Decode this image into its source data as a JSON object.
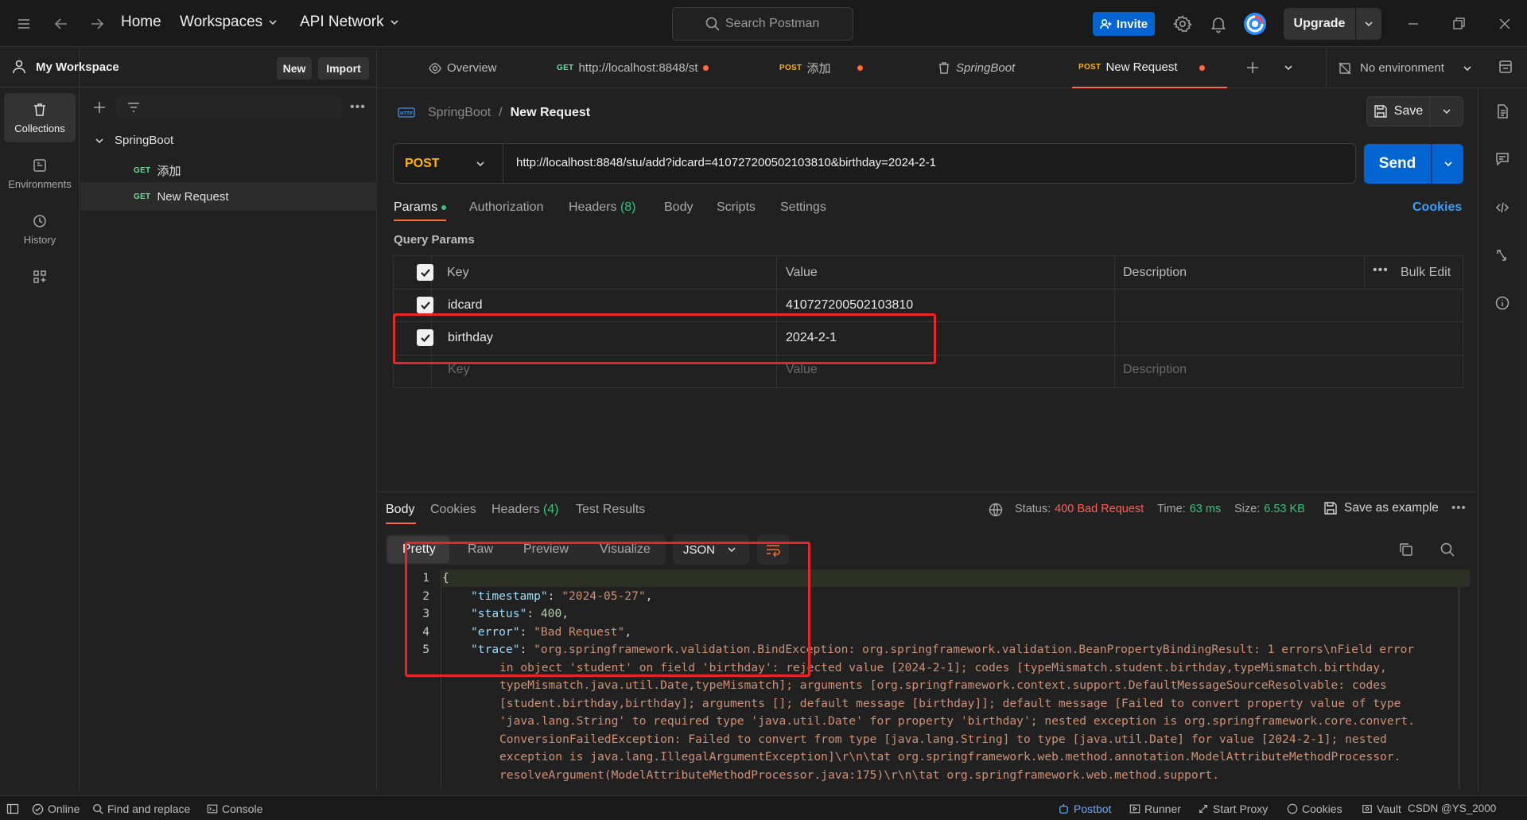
{
  "topbar": {
    "home": "Home",
    "workspaces": "Workspaces",
    "api_network": "API Network",
    "search_placeholder": "Search Postman",
    "invite": "Invite",
    "upgrade": "Upgrade"
  },
  "rail": {
    "collections": "Collections",
    "environments": "Environments",
    "history": "History"
  },
  "sidebar": {
    "workspace": "My Workspace",
    "new": "New",
    "import": "Import",
    "collection": "SpringBoot",
    "items": [
      {
        "method": "GET",
        "name": "添加"
      },
      {
        "method": "GET",
        "name": "New Request"
      }
    ]
  },
  "tabs": [
    {
      "method": "",
      "label": "Overview"
    },
    {
      "method": "GET",
      "label": "http://localhost:8848/st"
    },
    {
      "method": "POST",
      "label": "添加"
    },
    {
      "method": "",
      "label": "SpringBoot"
    },
    {
      "method": "POST",
      "label": "New Request"
    }
  ],
  "environment": "No environment",
  "breadcrumb": {
    "collection": "SpringBoot",
    "separator": "/",
    "request": "New Request"
  },
  "save": "Save",
  "request": {
    "method": "POST",
    "url": "http://localhost:8848/stu/add?idcard=410727200502103810&birthday=2024-2-1",
    "send": "Send",
    "tabs": [
      "Params",
      "Authorization",
      "Headers",
      "Body",
      "Scripts",
      "Settings"
    ],
    "headers_count": "(8)",
    "cookies": "Cookies",
    "query_params_title": "Query Params",
    "table": {
      "key": "Key",
      "value": "Value",
      "description": "Description",
      "bulk_edit": "Bulk Edit",
      "rows": [
        {
          "key": "idcard",
          "value": "410727200502103810"
        },
        {
          "key": "birthday",
          "value": "2024-2-1"
        }
      ],
      "placeholder_key": "Key",
      "placeholder_value": "Value",
      "placeholder_desc": "Description"
    }
  },
  "response": {
    "tabs": [
      "Body",
      "Cookies",
      "Headers",
      "Test Results"
    ],
    "headers_count": "(4)",
    "status_label": "Status:",
    "status_value": "400 Bad Request",
    "time_label": "Time:",
    "time_value": "63 ms",
    "size_label": "Size:",
    "size_value": "6.53 KB",
    "save_example": "Save as example",
    "view_tabs": [
      "Pretty",
      "Raw",
      "Preview",
      "Visualize"
    ],
    "format": "JSON",
    "line_numbers": [
      "1",
      "2",
      "3",
      "4",
      "5"
    ],
    "json": {
      "open": "{",
      "timestamp_key": "\"timestamp\"",
      "timestamp_val": "\"2024-05-27\"",
      "status_key": "\"status\"",
      "status_val": "400",
      "error_key": "\"error\"",
      "error_val": "\"Bad Request\"",
      "trace_key": "\"trace\"",
      "trace_lines": [
        "\"org.springframework.validation.BindException: org.springframework.validation.BeanPropertyBindingResult: 1 errors\\nField error",
        "in object 'student' on field 'birthday': rejected value [2024-2-1]; codes [typeMismatch.student.birthday,typeMismatch.birthday,",
        "typeMismatch.java.util.Date,typeMismatch]; arguments [org.springframework.context.support.DefaultMessageSourceResolvable: codes",
        "[student.birthday,birthday]; arguments []; default message [birthday]]; default message [Failed to convert property value of type",
        "'java.lang.String' to required type 'java.util.Date' for property 'birthday'; nested exception is org.springframework.core.convert.",
        "ConversionFailedException: Failed to convert from type [java.lang.String] to type [java.util.Date] for value [2024-2-1]; nested",
        "exception is java.lang.IllegalArgumentException]\\r\\n\\tat org.springframework.web.method.annotation.ModelAttributeMethodProcessor.",
        "resolveArgument(ModelAttributeMethodProcessor.java:175)\\r\\n\\tat org.springframework.web.method.support."
      ]
    }
  },
  "statusbar": {
    "online": "Online",
    "find_replace": "Find and replace",
    "console": "Console",
    "postbot": "Postbot",
    "runner": "Runner",
    "start_proxy": "Start Proxy",
    "cookies": "Cookies",
    "vault": "Vault",
    "watermark": "CSDN @YS_2000"
  },
  "colors": {
    "accent_blue": "#0265d2",
    "postman_orange": "#ff6c37",
    "status_error": "#ff5e57",
    "status_ok": "#36c37d",
    "highlight_red": "#e8252a"
  }
}
